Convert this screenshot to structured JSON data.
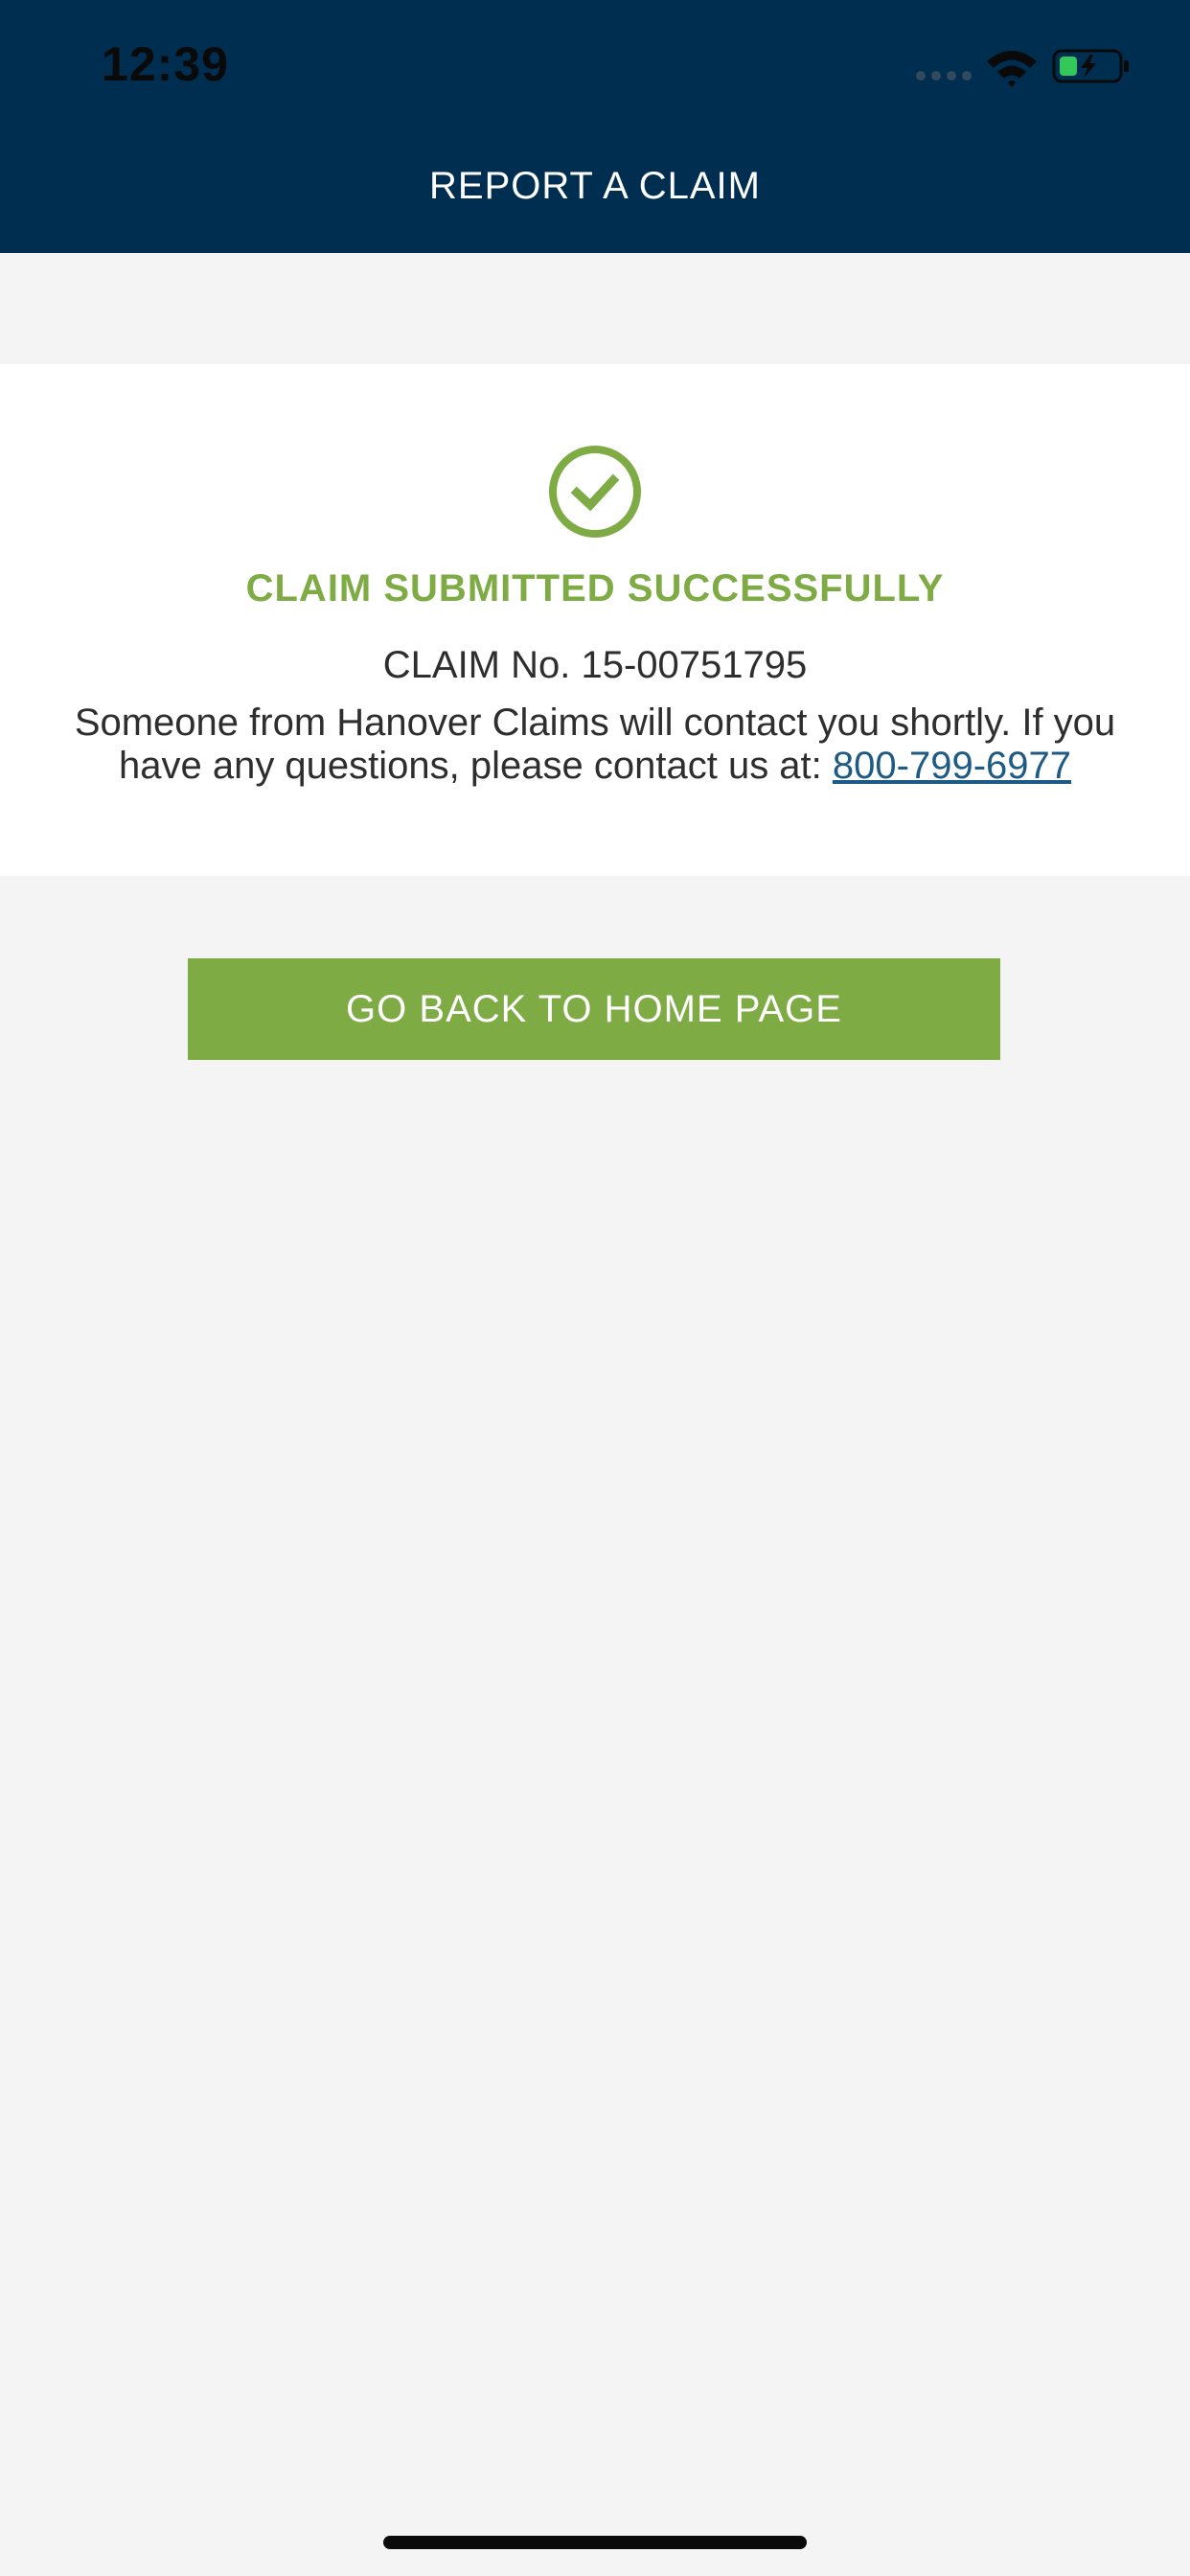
{
  "status_bar": {
    "time": "12:39",
    "wifi_icon": "wifi-icon",
    "battery_icon": "battery-charging-icon",
    "battery_color": "#34c759"
  },
  "header": {
    "title": "REPORT A CLAIM",
    "background": "#002e50"
  },
  "confirmation": {
    "icon": "check-circle-icon",
    "title": "CLAIM SUBMITTED SUCCESSFULLY",
    "claim_number": "CLAIM No. 15-00751795",
    "message": "Someone from Hanover Claims will contact you shortly. If you have any questions, please contact us at:",
    "phone": "800-799-6977",
    "accent": "#7eab44",
    "link_color": "#1e5a86"
  },
  "actions": {
    "home_button_label": "GO BACK TO HOME PAGE",
    "button_color": "#7eab44"
  }
}
